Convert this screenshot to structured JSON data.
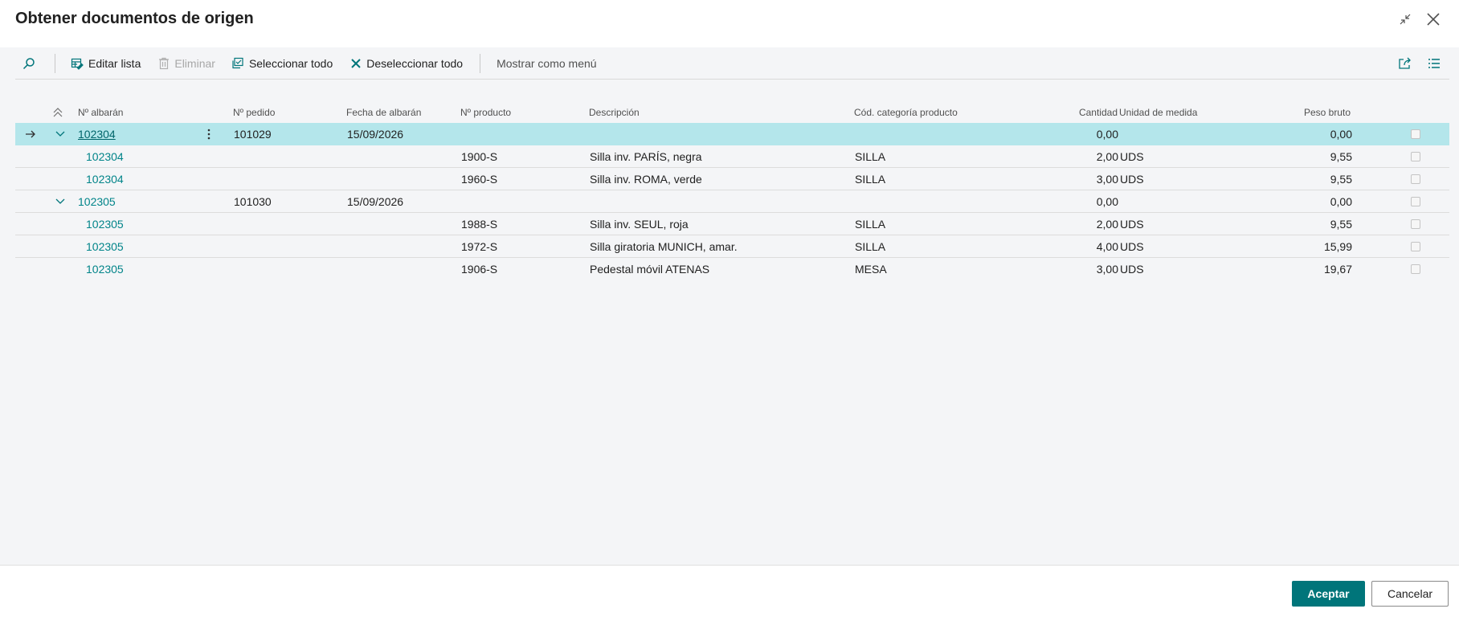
{
  "window": {
    "title": "Obtener documentos de origen"
  },
  "toolbar": {
    "edit_list": "Editar lista",
    "delete": "Eliminar",
    "select_all": "Seleccionar todo",
    "deselect_all": "Deseleccionar todo",
    "show_as_menu": "Mostrar como menú"
  },
  "columns": {
    "shipment_no": "Nº albarán",
    "order_no": "Nº pedido",
    "shipment_date": "Fecha de albarán",
    "item_no": "Nº producto",
    "description": "Descripción",
    "category": "Cód. categoría producto",
    "quantity": "Cantidad",
    "uom": "Unidad de medida",
    "gross_weight": "Peso bruto"
  },
  "rows": [
    {
      "shipment": "102304",
      "order": "101029",
      "date": "15/09/2026",
      "item": "",
      "desc": "",
      "cat": "",
      "qty": "0,00",
      "uom": "",
      "weight": "0,00"
    },
    {
      "shipment": "102304",
      "order": "",
      "date": "",
      "item": "1900-S",
      "desc": "Silla inv. PARÍS, negra",
      "cat": "SILLA",
      "qty": "2,00",
      "uom": "UDS",
      "weight": "9,55"
    },
    {
      "shipment": "102304",
      "order": "",
      "date": "",
      "item": "1960-S",
      "desc": "Silla inv. ROMA, verde",
      "cat": "SILLA",
      "qty": "3,00",
      "uom": "UDS",
      "weight": "9,55"
    },
    {
      "shipment": "102305",
      "order": "101030",
      "date": "15/09/2026",
      "item": "",
      "desc": "",
      "cat": "",
      "qty": "0,00",
      "uom": "",
      "weight": "0,00"
    },
    {
      "shipment": "102305",
      "order": "",
      "date": "",
      "item": "1988-S",
      "desc": "Silla inv. SEUL, roja",
      "cat": "SILLA",
      "qty": "2,00",
      "uom": "UDS",
      "weight": "9,55"
    },
    {
      "shipment": "102305",
      "order": "",
      "date": "",
      "item": "1972-S",
      "desc": "Silla giratoria MUNICH, amar.",
      "cat": "SILLA",
      "qty": "4,00",
      "uom": "UDS",
      "weight": "15,99"
    },
    {
      "shipment": "102305",
      "order": "",
      "date": "",
      "item": "1906-S",
      "desc": "Pedestal móvil ATENAS",
      "cat": "MESA",
      "qty": "3,00",
      "uom": "UDS",
      "weight": "19,67"
    }
  ],
  "footer": {
    "ok": "Aceptar",
    "cancel": "Cancelar"
  },
  "colors": {
    "accent": "#00757a",
    "selected_row": "#b4e6eb",
    "link": "#008489"
  }
}
